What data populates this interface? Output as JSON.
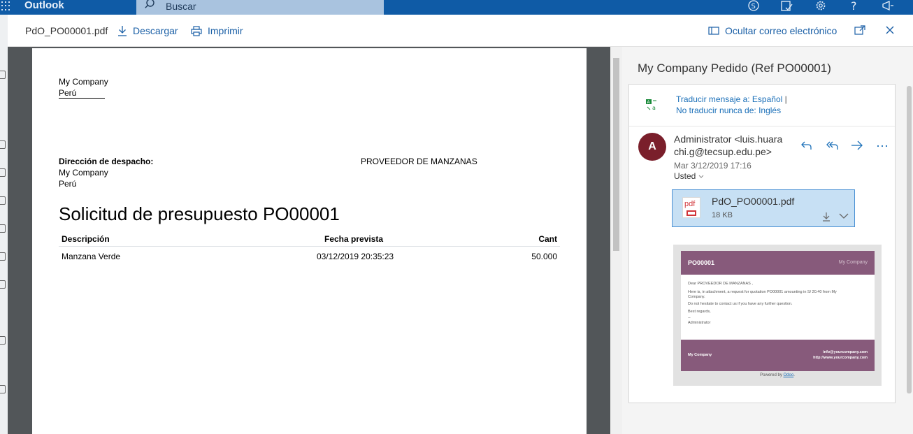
{
  "topbar": {
    "brand": "Outlook",
    "search_placeholder": "Buscar"
  },
  "viewer": {
    "file_name": "PdO_PO00001.pdf",
    "download_label": "Descargar",
    "print_label": "Imprimir",
    "hide_email_label": "Ocultar correo electrónico"
  },
  "document": {
    "company_line1": "My Company",
    "company_line2": "Perú",
    "shipping_label": "Dirección de despacho:",
    "shipping_line1": "My Company",
    "shipping_line2": "Perú",
    "vendor": "PROVEEDOR DE MANZANAS",
    "title": "Solicitud de presupuesto PO00001",
    "columns": [
      "Descripción",
      "Fecha prevista",
      "Cant"
    ],
    "rows": [
      [
        "Manzana Verde",
        "03/12/2019 20:35:23",
        "50.000"
      ]
    ]
  },
  "email": {
    "subject": "My Company Pedido (Ref PO00001)",
    "translate_link": "Traducir mensaje a: Español",
    "translate_sep": " |",
    "never_translate_link": "No traducir nunca de: Inglés",
    "avatar_initial": "A",
    "sender": "Administrator <luis.huarachi.g@tecsup.edu.pe>",
    "date": "Mar 3/12/2019 17:16",
    "to": "Usted",
    "attachment": {
      "name": "PdO_PO00001.pdf",
      "size": "18 KB",
      "icon_label": "pdf"
    },
    "preview": {
      "ref": "PO00001",
      "company_logo_text": "My Company",
      "greeting": "Dear PROVEEDOR DE MANZANAS ,",
      "body_line1": "Here is, in attachment, a request for quotation PO00001 amounting in S/ 20.40 from My",
      "body_line2": "Company.",
      "body_line3": "Do not hesitate to contact us if you have any further question.",
      "regards": "Best regards,",
      "dashes": "--",
      "signature": "Administrator",
      "footer_company": "My Company",
      "footer_email": "info@yourcompany.com",
      "footer_web": "http://www.yourcompany.com",
      "powered_by": "Powered by ",
      "odoo": "Odoo",
      "powered_end": "."
    }
  },
  "colors": {
    "topbar": "#0f5ba6",
    "link": "#1a5fa6",
    "avatar": "#7a1f2b",
    "odoo_purple": "#875a7b",
    "attachment_bg": "#c7e0f4"
  },
  "icons": [
    "waffle-icon",
    "search-icon",
    "skype-icon",
    "tasks-icon",
    "gear-icon",
    "help-icon",
    "megaphone-icon",
    "download-icon",
    "print-icon",
    "hide-email-icon",
    "popout-icon",
    "close-icon",
    "translate-icon",
    "reply-icon",
    "reply-all-icon",
    "forward-icon",
    "more-icon",
    "pdf-icon",
    "chevron-down-icon"
  ]
}
